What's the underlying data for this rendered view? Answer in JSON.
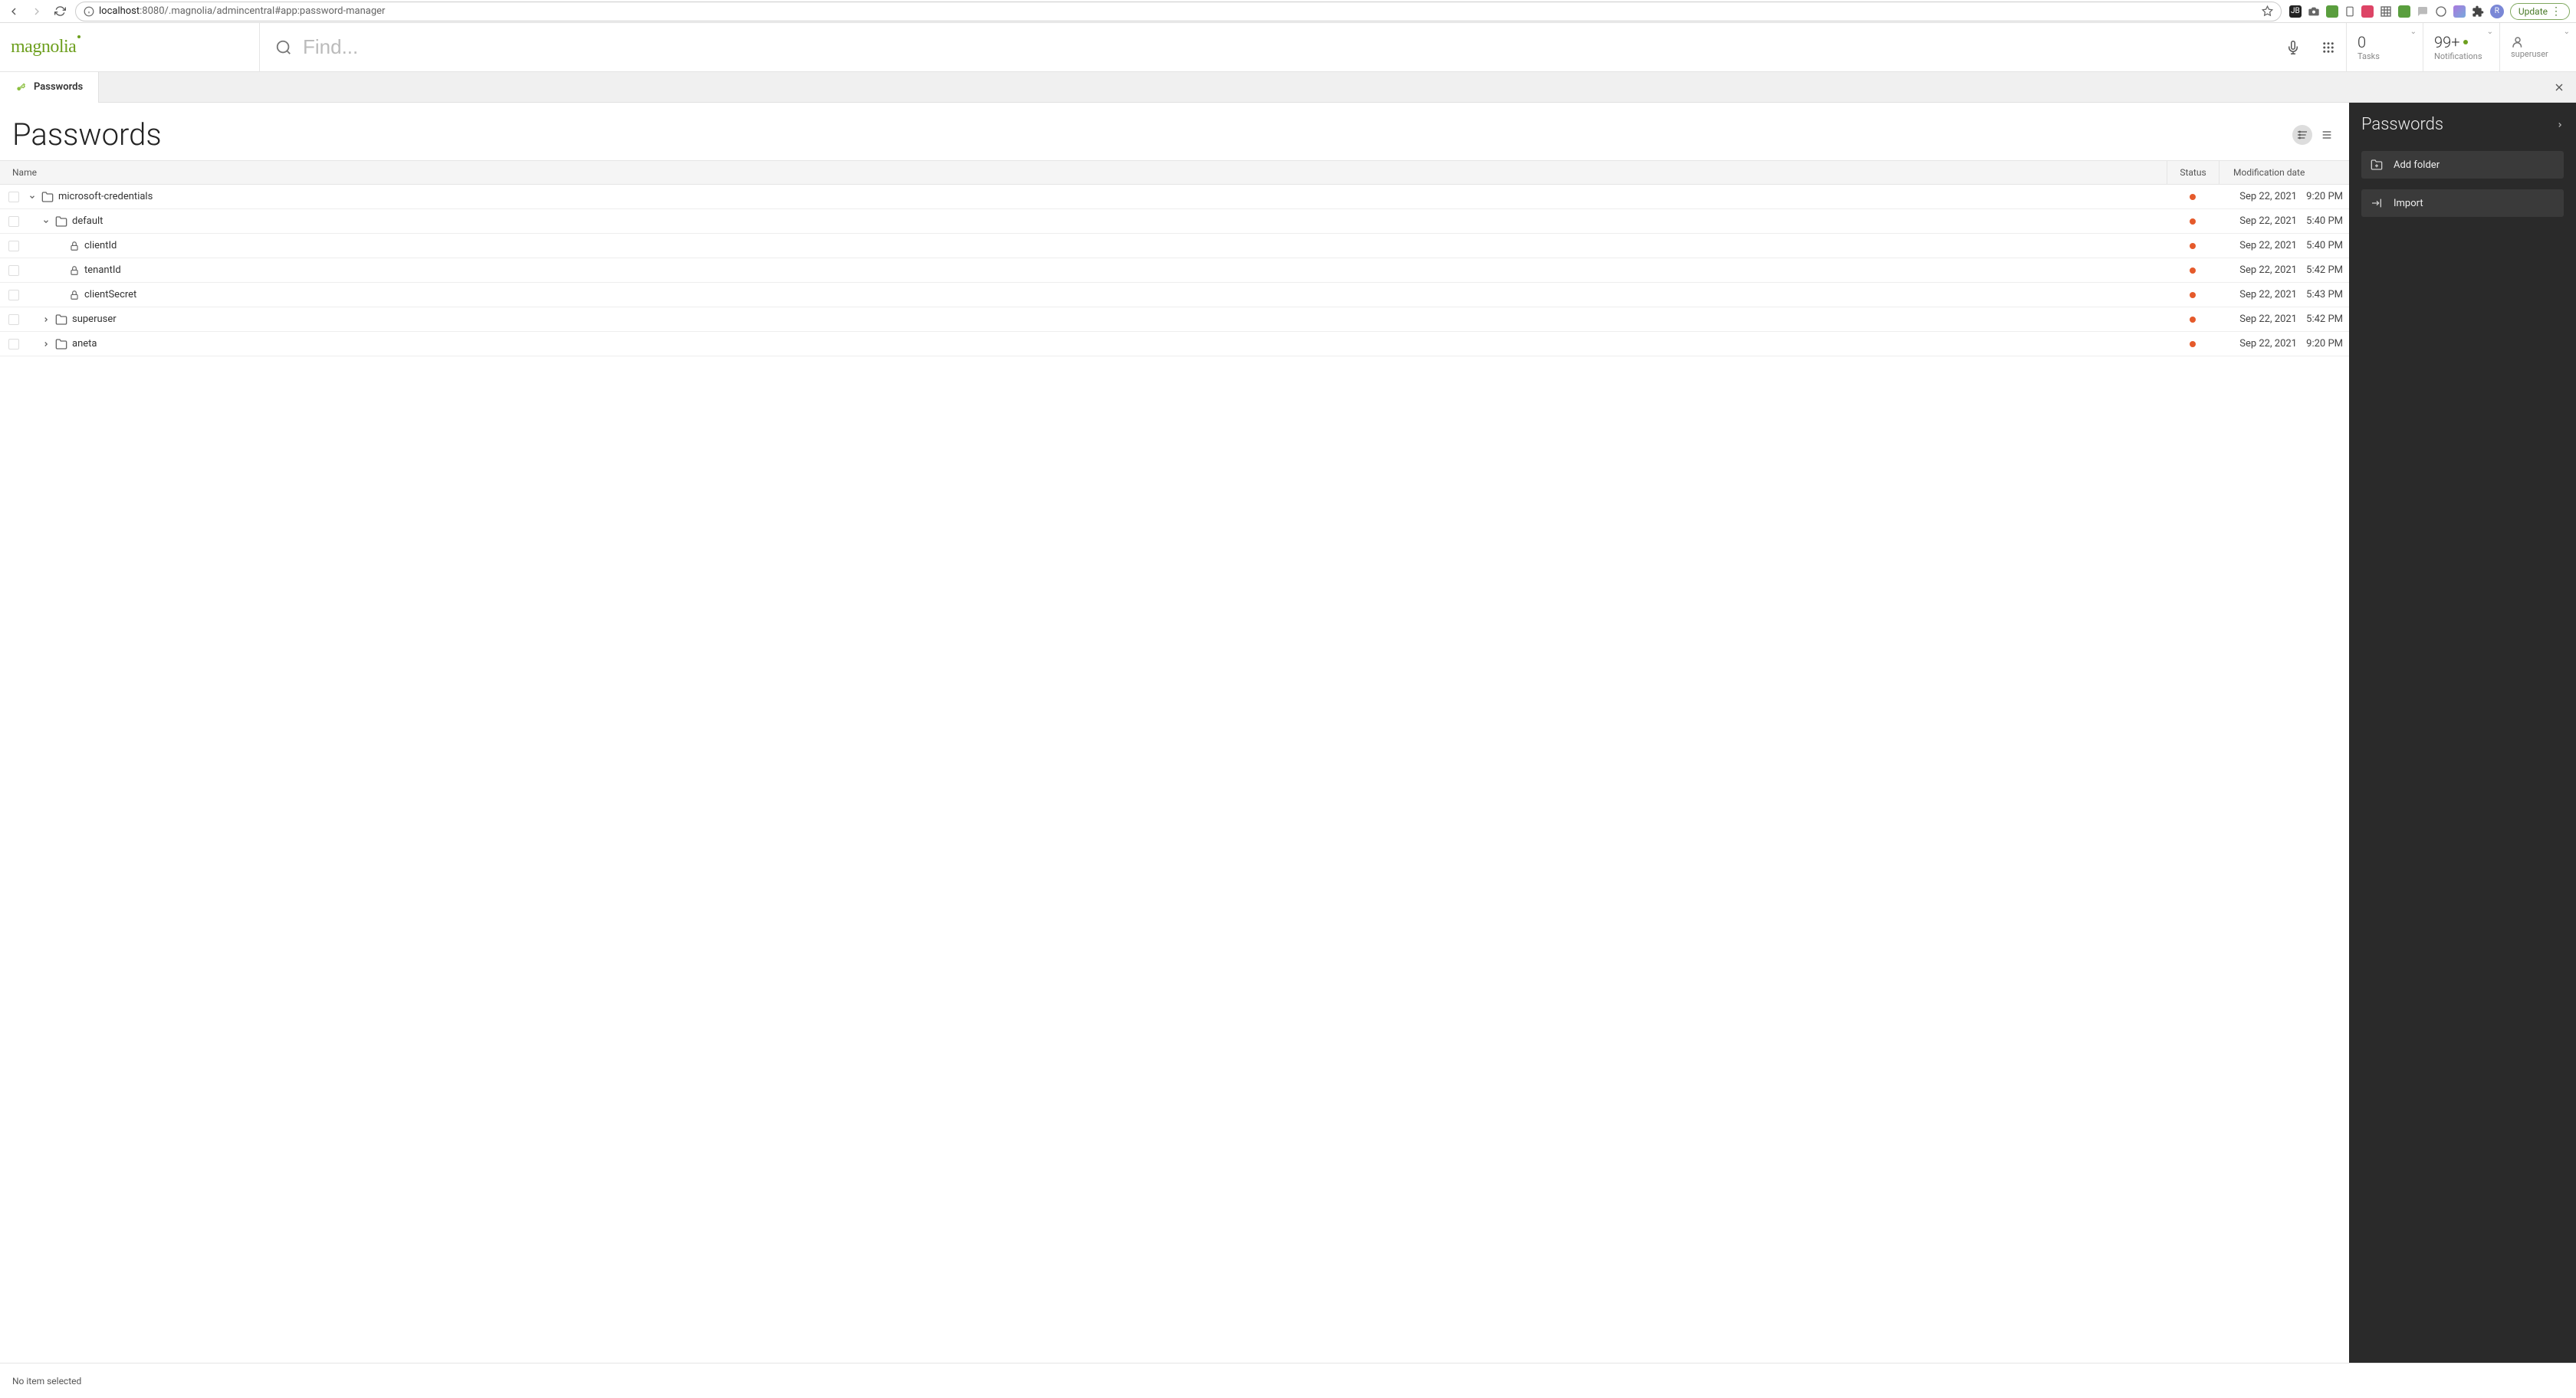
{
  "browser": {
    "url_host": "localhost",
    "url_path": ":8080/.magnolia/admincentral#app:password-manager",
    "update_label": "Update",
    "avatar_letter": "R"
  },
  "header": {
    "logo": "magnolia",
    "search_placeholder": "Find...",
    "tasks_count": "0",
    "tasks_label": "Tasks",
    "notifications_count": "99+",
    "notifications_label": "Notifications",
    "user": "superuser"
  },
  "tab": {
    "label": "Passwords"
  },
  "page": {
    "title": "Passwords"
  },
  "columns": {
    "name": "Name",
    "status": "Status",
    "mod": "Modification date"
  },
  "rows": [
    {
      "indent": 0,
      "expanded": true,
      "type": "folder",
      "name": "microsoft-credentials",
      "date": "Sep 22, 2021",
      "time": "9:20 PM"
    },
    {
      "indent": 1,
      "expanded": true,
      "type": "folder",
      "name": "default",
      "date": "Sep 22, 2021",
      "time": "5:40 PM"
    },
    {
      "indent": 2,
      "expanded": null,
      "type": "pwd",
      "name": "clientId",
      "date": "Sep 22, 2021",
      "time": "5:40 PM"
    },
    {
      "indent": 2,
      "expanded": null,
      "type": "pwd",
      "name": "tenantId",
      "date": "Sep 22, 2021",
      "time": "5:42 PM"
    },
    {
      "indent": 2,
      "expanded": null,
      "type": "pwd",
      "name": "clientSecret",
      "date": "Sep 22, 2021",
      "time": "5:43 PM"
    },
    {
      "indent": 1,
      "expanded": false,
      "type": "folder",
      "name": "superuser",
      "date": "Sep 22, 2021",
      "time": "5:42 PM"
    },
    {
      "indent": 1,
      "expanded": false,
      "type": "folder",
      "name": "aneta",
      "date": "Sep 22, 2021",
      "time": "9:20 PM"
    }
  ],
  "panel": {
    "title": "Passwords",
    "add_folder": "Add folder",
    "import": "Import"
  },
  "statusbar": {
    "text": "No item selected"
  }
}
